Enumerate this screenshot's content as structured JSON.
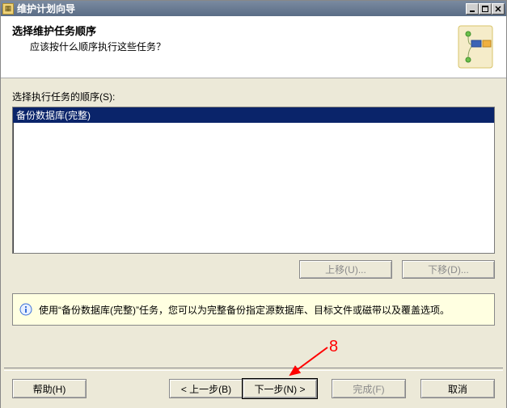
{
  "window": {
    "title": "维护计划向导"
  },
  "header": {
    "heading": "选择维护任务顺序",
    "subheading": "应该按什么顺序执行这些任务？"
  },
  "body": {
    "order_label": "选择执行任务的顺序(S):",
    "tasks": [
      {
        "label": "备份数据库(完整)",
        "selected": true
      }
    ],
    "move_up": "上移(U)...",
    "move_down": "下移(D)..."
  },
  "info": {
    "text": "使用“备份数据库(完整)”任务，您可以为完整备份指定源数据库、目标文件或磁带以及覆盖选项。"
  },
  "buttons": {
    "help": "帮助(H)",
    "back": "< 上一步(B)",
    "next": "下一步(N) >",
    "finish": "完成(F)",
    "cancel": "取消"
  },
  "annotation": {
    "number": "8"
  }
}
